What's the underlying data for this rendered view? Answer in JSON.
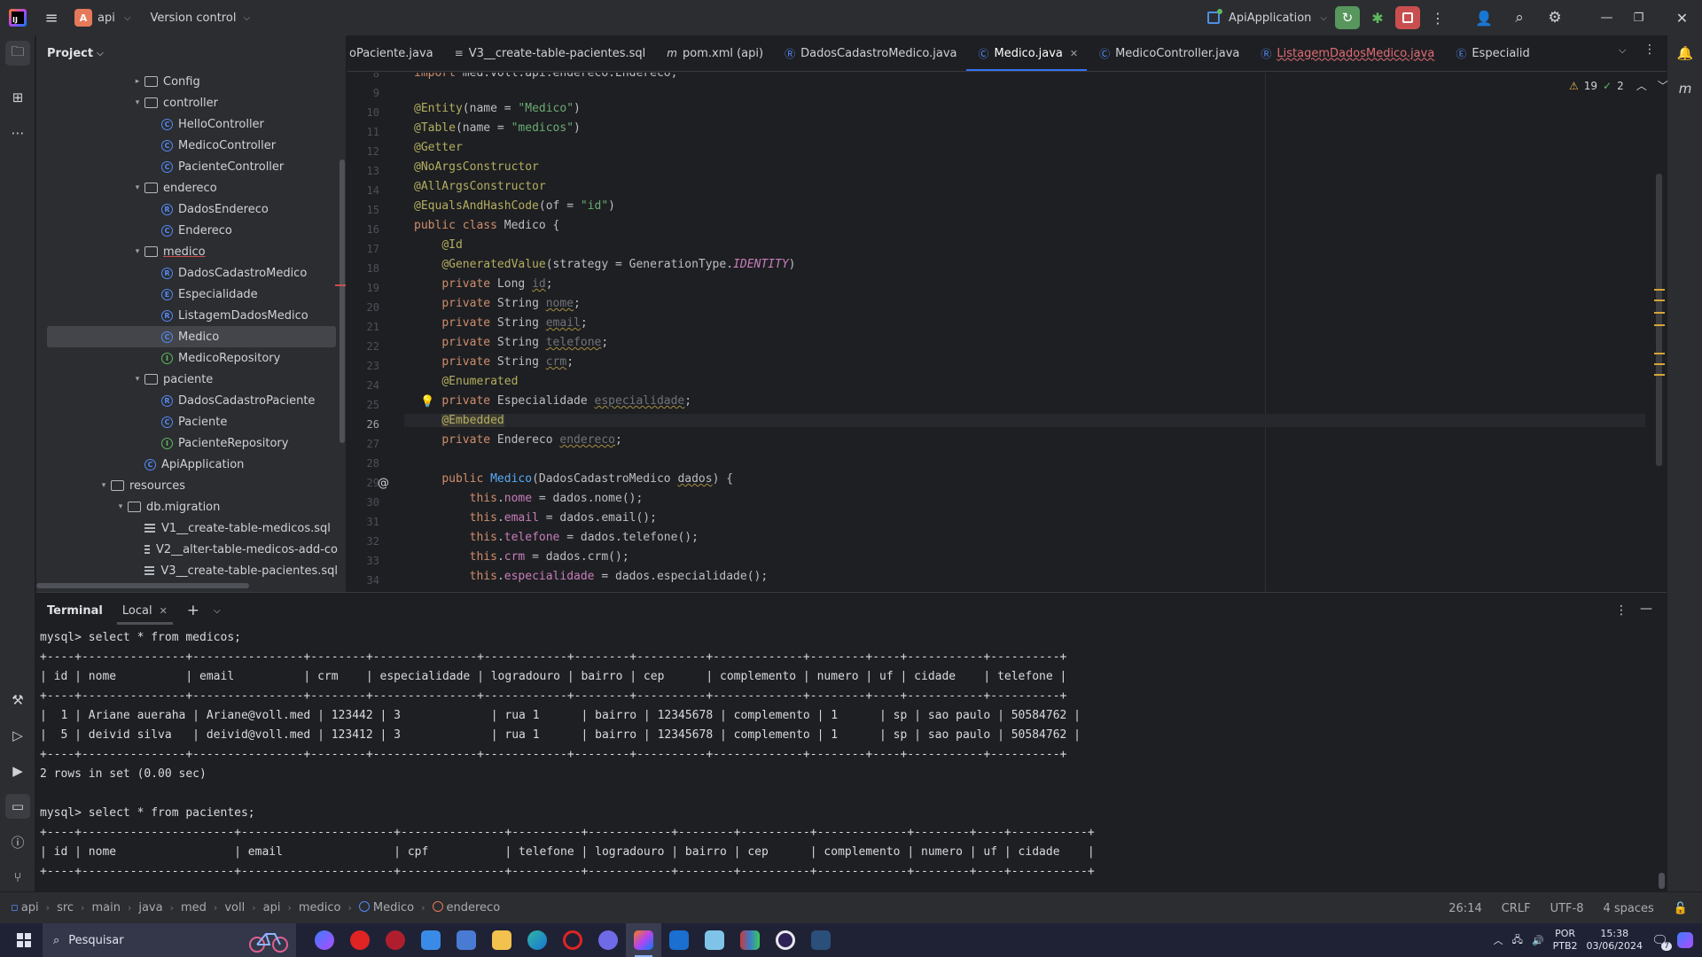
{
  "titlebar": {
    "project_letter": "A",
    "project_name": "api",
    "vcs_label": "Version control",
    "run_config": "ApiApplication"
  },
  "project_panel": {
    "title": "Project",
    "tree": [
      {
        "label": "Config",
        "kind": "folder",
        "expanded": false
      },
      {
        "label": "controller",
        "kind": "folder",
        "expanded": true
      },
      {
        "label": "HelloController",
        "kind": "class"
      },
      {
        "label": "MedicoController",
        "kind": "class"
      },
      {
        "label": "PacienteController",
        "kind": "class"
      },
      {
        "label": "endereco",
        "kind": "folder",
        "expanded": true
      },
      {
        "label": "DadosEndereco",
        "kind": "record"
      },
      {
        "label": "Endereco",
        "kind": "class"
      },
      {
        "label": "medico",
        "kind": "folder",
        "expanded": true
      },
      {
        "label": "DadosCadastroMedico",
        "kind": "record"
      },
      {
        "label": "Especialidade",
        "kind": "enum"
      },
      {
        "label": "ListagemDadosMedico",
        "kind": "record"
      },
      {
        "label": "Medico",
        "kind": "class",
        "selected": true
      },
      {
        "label": "MedicoRepository",
        "kind": "interface"
      },
      {
        "label": "paciente",
        "kind": "folder",
        "expanded": true
      },
      {
        "label": "DadosCadastroPaciente",
        "kind": "record"
      },
      {
        "label": "Paciente",
        "kind": "class"
      },
      {
        "label": "PacienteRepository",
        "kind": "interface"
      },
      {
        "label": "ApiApplication",
        "kind": "class"
      },
      {
        "label": "resources",
        "kind": "folder",
        "expanded": true
      },
      {
        "label": "db.migration",
        "kind": "folder",
        "expanded": true
      },
      {
        "label": "V1__create-table-medicos.sql",
        "kind": "sql"
      },
      {
        "label": "V2__alter-table-medicos-add-co",
        "kind": "sql"
      },
      {
        "label": "V3__create-table-pacientes.sql",
        "kind": "sql"
      }
    ]
  },
  "editor_tabs": [
    {
      "label": "oPaciente.java",
      "icon": "class-icon"
    },
    {
      "label": "V3__create-table-pacientes.sql",
      "icon": "sql-icon"
    },
    {
      "label": "pom.xml (api)",
      "icon": "maven-icon"
    },
    {
      "label": "DadosCadastroMedico.java",
      "icon": "record-icon"
    },
    {
      "label": "Medico.java",
      "icon": "class-icon",
      "active": true
    },
    {
      "label": "MedicoController.java",
      "icon": "class-icon"
    },
    {
      "label": "ListagemDadosMedico.java",
      "icon": "record-icon",
      "error": true
    },
    {
      "label": "Especialid",
      "icon": "enum-icon"
    }
  ],
  "inspections": {
    "warnings": "19",
    "weak_warnings": "2"
  },
  "code": {
    "line_numbers": [
      "8",
      "9",
      "10",
      "11",
      "12",
      "13",
      "14",
      "15",
      "16",
      "17",
      "18",
      "19",
      "20",
      "21",
      "22",
      "23",
      "24",
      "25",
      "26",
      "27",
      "28",
      "29",
      "30",
      "31",
      "32",
      "33",
      "34"
    ],
    "current_line": "26"
  },
  "terminal": {
    "title": "Terminal",
    "tab_label": "Local",
    "lines": [
      "mysql> select * from medicos;",
      "+----+---------------+----------------+--------+---------------+------------+--------+----------+-------------+--------+----+-----------+----------+",
      "| id | nome          | email          | crm    | especialidade | logradouro | bairro | cep      | complemento | numero | uf | cidade    | telefone |",
      "+----+---------------+----------------+--------+---------------+------------+--------+----------+-------------+--------+----+-----------+----------+",
      "|  1 | Ariane aueraha | Ariane@voll.med | 123442 | 3             | rua 1      | bairro | 12345678 | complemento | 1      | sp | sao paulo | 50584762 |",
      "|  5 | deivid silva   | deivid@voll.med | 123412 | 3             | rua 1      | bairro | 12345678 | complemento | 1      | sp | sao paulo | 50584762 |",
      "+----+---------------+----------------+--------+---------------+------------+--------+----------+-------------+--------+----+-----------+----------+",
      "2 rows in set (0.00 sec)",
      "",
      "mysql> select * from pacientes;",
      "+----+----------------------+----------------------+---------------+----------+------------+--------+----------+-------------+--------+----+-----------+",
      "| id | nome                 | email                | cpf           | telefone | logradouro | bairro | cep      | complemento | numero | uf | cidade    |",
      "+----+----------------------+----------------------+---------------+----------+------------+--------+----------+-------------+--------+----+-----------+"
    ]
  },
  "statusbar": {
    "breadcrumbs": [
      "api",
      "src",
      "main",
      "java",
      "med",
      "voll",
      "api",
      "medico",
      "Medico",
      "endereco"
    ],
    "position": "26:14",
    "line_sep": "CRLF",
    "encoding": "UTF-8",
    "indent": "4 spaces"
  },
  "taskbar": {
    "search_placeholder": "Pesquisar",
    "lang_top": "POR",
    "lang_bottom": "PTB2",
    "time": "15:38",
    "date": "03/06/2024",
    "notif_count": "7"
  },
  "colors": {
    "accent": "#3574f0",
    "rerun_green": "#57965c",
    "stop_red": "#c94f4f"
  }
}
